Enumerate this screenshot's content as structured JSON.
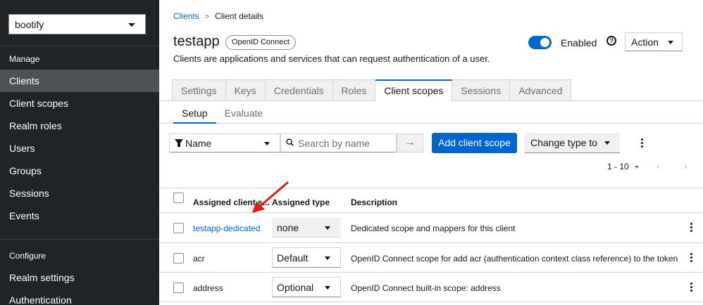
{
  "sidebar": {
    "realm": "bootify",
    "manage_title": "Manage",
    "manage_items": [
      "Clients",
      "Client scopes",
      "Realm roles",
      "Users",
      "Groups",
      "Sessions",
      "Events"
    ],
    "configure_title": "Configure",
    "configure_items": [
      "Realm settings",
      "Authentication"
    ],
    "active_item": "Clients"
  },
  "breadcrumb": {
    "parent": "Clients",
    "current": "Client details"
  },
  "header": {
    "title": "testapp",
    "protocol_badge": "OpenID Connect",
    "subtitle": "Clients are applications and services that can request authentication of a user.",
    "enabled_label": "Enabled",
    "enabled": true,
    "action_label": "Action"
  },
  "tabs": [
    "Settings",
    "Keys",
    "Credentials",
    "Roles",
    "Client scopes",
    "Sessions",
    "Advanced"
  ],
  "active_tab": "Client scopes",
  "subtabs": [
    "Setup",
    "Evaluate"
  ],
  "active_subtab": "Setup",
  "toolbar": {
    "filter_label": "Name",
    "search_placeholder": "Search by name",
    "add_button": "Add client scope",
    "change_type": "Change type to",
    "pagination": "1 - 10",
    "prev": "‹",
    "next": "›"
  },
  "table": {
    "columns": [
      "Assigned client s...",
      "Assigned type",
      "Description"
    ],
    "rows": [
      {
        "name": "testapp-dedicated",
        "type": "none",
        "description": "Dedicated scope and mappers for this client",
        "link": true
      },
      {
        "name": "acr",
        "type": "Default",
        "description": "OpenID Connect scope for add acr (authentication context class reference) to the token",
        "link": false
      },
      {
        "name": "address",
        "type": "Optional",
        "description": "OpenID Connect built-in scope: address",
        "link": false
      }
    ]
  },
  "colors": {
    "accent": "#0066cc",
    "sidebar_bg": "#212427",
    "annotation": "#e01b1b"
  }
}
